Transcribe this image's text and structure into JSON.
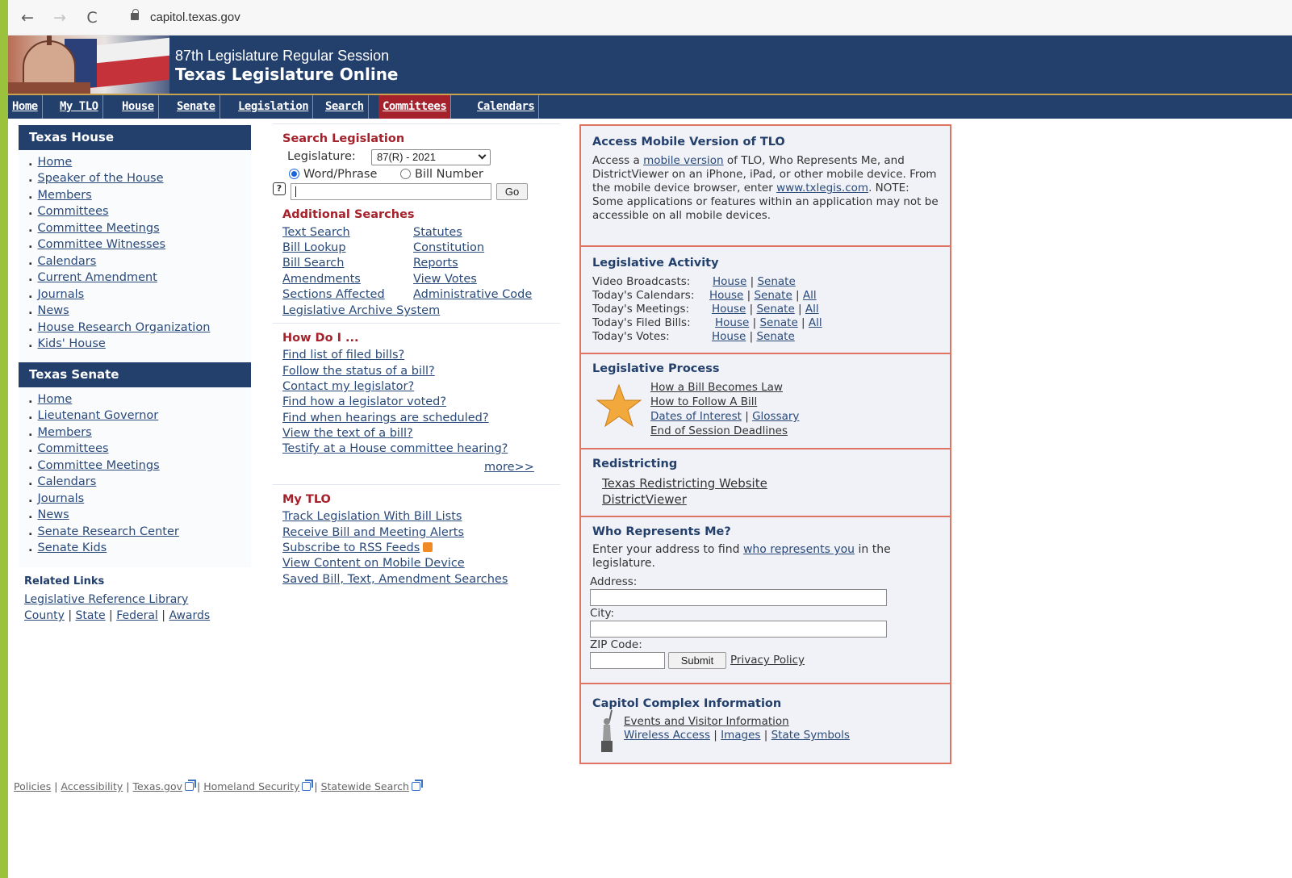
{
  "browser": {
    "back_icon": "←",
    "forward_icon": "→",
    "reload_icon": "C",
    "url": "capitol.texas.gov"
  },
  "header": {
    "subtitle": "87th Legislature Regular Session",
    "title": "Texas Legislature Online"
  },
  "topnav": [
    "Home",
    "My TLO",
    "House",
    "Senate",
    "Legislation",
    "Search",
    "Committees",
    "Calendars"
  ],
  "topnav_active": "Committees",
  "texas_house": {
    "heading": "Texas House",
    "items": [
      "Home",
      "Speaker of the House",
      "Members",
      "Committees",
      "Committee Meetings",
      "Committee Witnesses",
      "Calendars",
      "Current Amendment",
      "Journals",
      "News",
      "House Research Organization",
      "Kids' House"
    ]
  },
  "texas_senate": {
    "heading": "Texas Senate",
    "items": [
      "Home",
      "Lieutenant Governor",
      "Members",
      "Committees",
      "Committee Meetings",
      "Calendars",
      "Journals",
      "News",
      "Senate Research Center",
      "Senate Kids"
    ]
  },
  "related": {
    "heading": "Related Links",
    "line1": "Legislative Reference Library",
    "line2": [
      "County",
      "State",
      "Federal",
      "Awards"
    ],
    "sep": "|"
  },
  "search": {
    "heading": "Search Legislation",
    "legislature_label": "Legislature:",
    "legislature_value": "87(R) - 2021",
    "radio_word": "Word/Phrase",
    "radio_bill": "Bill Number",
    "help": "?",
    "go": "Go"
  },
  "additional": {
    "heading": "Additional Searches",
    "col1": [
      "Text Search",
      "Bill Lookup",
      "Bill Search",
      "Amendments",
      "Sections Affected"
    ],
    "col2": [
      "Statutes",
      "Constitution",
      "Reports",
      "View Votes",
      "Administrative Code"
    ],
    "archive": "Legislative Archive System"
  },
  "howdoi": {
    "heading": "How Do I ...",
    "items": [
      "Find list of filed bills?",
      "Follow the status of a bill?",
      "Contact my legislator?",
      "Find how a legislator voted?",
      "Find when hearings are scheduled?",
      "View the text of a bill?",
      "Testify at a House committee hearing?"
    ],
    "more": "more>>"
  },
  "mytlo": {
    "heading": "My TLO",
    "items": [
      "Track Legislation With Bill Lists",
      "Receive Bill and Meeting Alerts",
      "Subscribe to RSS Feeds",
      "View Content on Mobile Device",
      "Saved Bill, Text, Amendment Searches"
    ]
  },
  "mobile": {
    "heading": "Access Mobile Version of TLO",
    "t1": "Access a ",
    "link1": "mobile version",
    "t2": " of TLO, Who Represents Me, and DistrictViewer on an iPhone, iPad, or other mobile device. From the mobile device browser, enter ",
    "link2": "www.txlegis.com",
    "t3": ". NOTE: Some applications or features within an application may not be accessible on all mobile devices."
  },
  "activity": {
    "heading": "Legislative Activity",
    "rows": [
      {
        "label": "Video Broadcasts:",
        "links": [
          "House",
          "Senate"
        ]
      },
      {
        "label": "Today's Calendars:",
        "links": [
          "House",
          "Senate",
          "All"
        ]
      },
      {
        "label": "Today's Meetings:",
        "links": [
          "House",
          "Senate",
          "All"
        ]
      },
      {
        "label": "Today's Filed Bills:",
        "links": [
          "House",
          "Senate",
          "All"
        ]
      },
      {
        "label": "Today's Votes:",
        "links": [
          "House",
          "Senate"
        ]
      }
    ]
  },
  "process": {
    "heading": "Legislative Process",
    "l1": "How a Bill Becomes Law",
    "l2": "How to Follow A Bill",
    "l3a": "Dates of Interest",
    "l3b": "Glossary",
    "l4": "End of Session Deadlines"
  },
  "redistricting": {
    "heading": "Redistricting",
    "l1": "Texas Redistricting Website",
    "l2": "DistrictViewer"
  },
  "who": {
    "heading": "Who Represents Me?",
    "t1": "Enter your address to find ",
    "link": "who represents you",
    "t2": " in the legislature.",
    "address_label": "Address:",
    "city_label": "City:",
    "zip_label": "ZIP Code:",
    "submit": "Submit",
    "privacy": "Privacy Policy"
  },
  "capitol": {
    "heading": "Capitol Complex Information",
    "l1": "Events and Visitor Information",
    "l2a": "Wireless Access",
    "l2b": "Images",
    "l2c": "State Symbols"
  },
  "footer": {
    "items": [
      "Policies",
      "Accessibility",
      "Texas.gov",
      "Homeland Security",
      "Statewide Search"
    ]
  },
  "colors": {
    "navy": "#233f6c",
    "red": "#a5212b",
    "border": "#e07462",
    "frame": "#9bc23c"
  }
}
